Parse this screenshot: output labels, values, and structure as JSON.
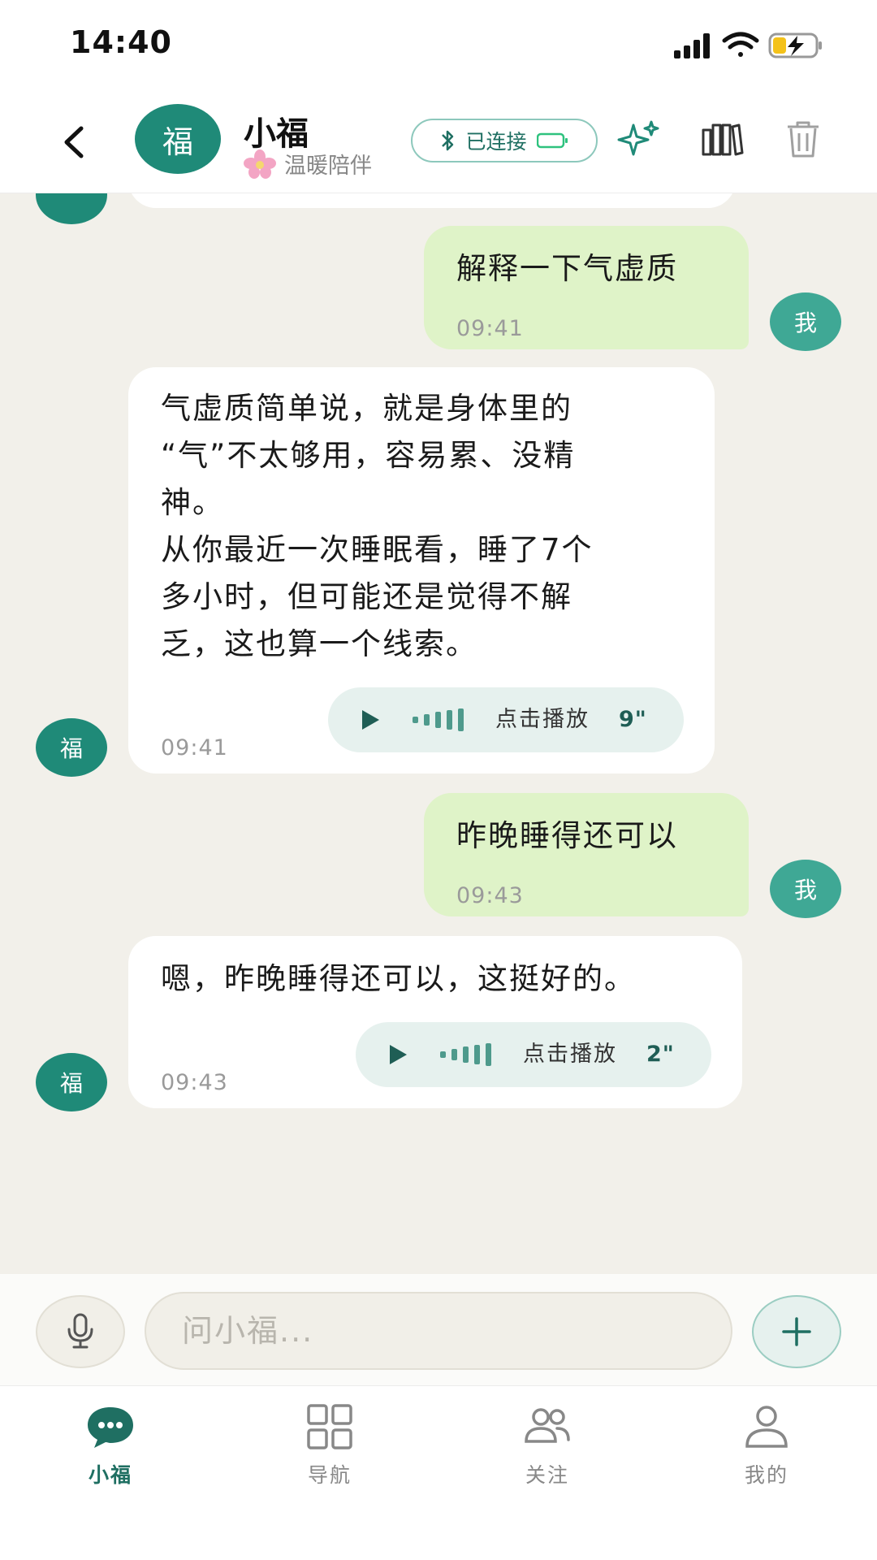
{
  "status_bar": {
    "time": "14:40"
  },
  "header": {
    "back_icon": "chevron-left-icon",
    "avatar_char": "福",
    "name": "小福",
    "subtitle": "温暖陪伴",
    "connection": {
      "label": "已连接",
      "icon": "bluetooth-icon",
      "battery_icon": "battery-icon"
    },
    "actions": [
      {
        "name": "sparkle-icon"
      },
      {
        "name": "library-icon"
      },
      {
        "name": "trash-icon"
      }
    ]
  },
  "messages": [
    {
      "role": "me",
      "avatar": "我",
      "text": "解释一下气虚质",
      "time": "09:41"
    },
    {
      "role": "bot",
      "avatar": "福",
      "lines": [
        "气虚质简单说，就是身体里的",
        "“气”不太够用，容易累、没精",
        "神。",
        "从你最近一次睡眠看，睡了7个",
        "多小时，但可能还是觉得不解",
        "乏，这也算一个线索。"
      ],
      "time": "09:41",
      "voice": {
        "label": "点击播放",
        "duration": "9\""
      }
    },
    {
      "role": "me",
      "avatar": "我",
      "text": "昨晚睡得还可以",
      "time": "09:43"
    },
    {
      "role": "bot",
      "avatar": "福",
      "lines": [
        "嗯，昨晚睡得还可以，这挺好的。"
      ],
      "time": "09:43",
      "voice": {
        "label": "点击播放",
        "duration": "2\""
      }
    }
  ],
  "input": {
    "placeholder": "问小福...",
    "value": ""
  },
  "nav": [
    {
      "label": "小福",
      "icon": "chat-bubble-icon",
      "active": true
    },
    {
      "label": "导航",
      "icon": "grid-icon",
      "active": false
    },
    {
      "label": "关注",
      "icon": "people-icon",
      "active": false
    },
    {
      "label": "我的",
      "icon": "person-icon",
      "active": false
    }
  ],
  "colors": {
    "primary": "#1f8a78",
    "me_bubble": "#dff3c8",
    "chat_bg": "#f2f0ea"
  }
}
